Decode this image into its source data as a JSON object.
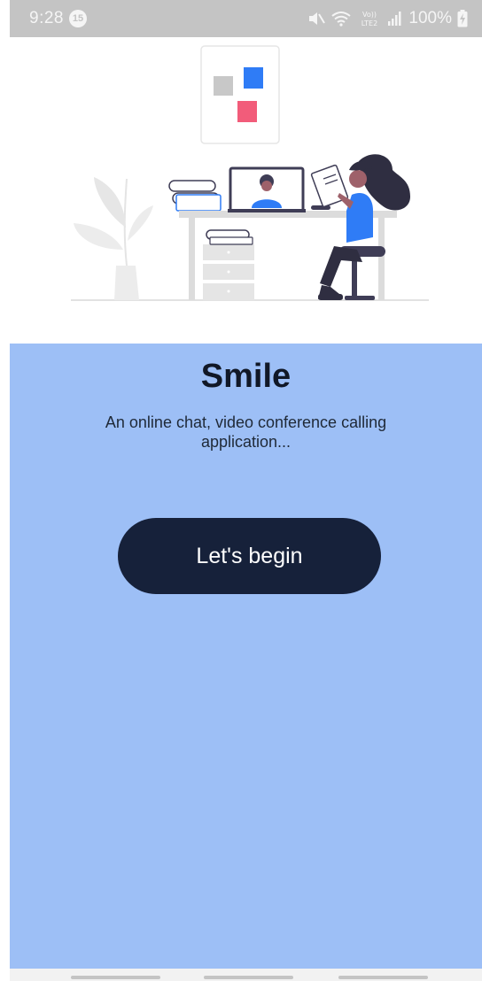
{
  "status_bar": {
    "time": "9:28",
    "notification_count": "15",
    "battery": "100%",
    "icons": [
      "mute-icon",
      "wifi-icon",
      "volte-icon",
      "signal-icon",
      "battery-charging-icon"
    ],
    "volte_line1": "Vo))",
    "volte_line2": "LTE2"
  },
  "onboarding": {
    "title": "Smile",
    "subtitle": "An online chat, video conference calling application...",
    "cta_label": "Let's begin"
  },
  "colors": {
    "panel_bg": "#9dbff6",
    "button_bg": "#16213a",
    "accent_blue": "#2f7cf6",
    "accent_pink": "#f25c7a"
  }
}
